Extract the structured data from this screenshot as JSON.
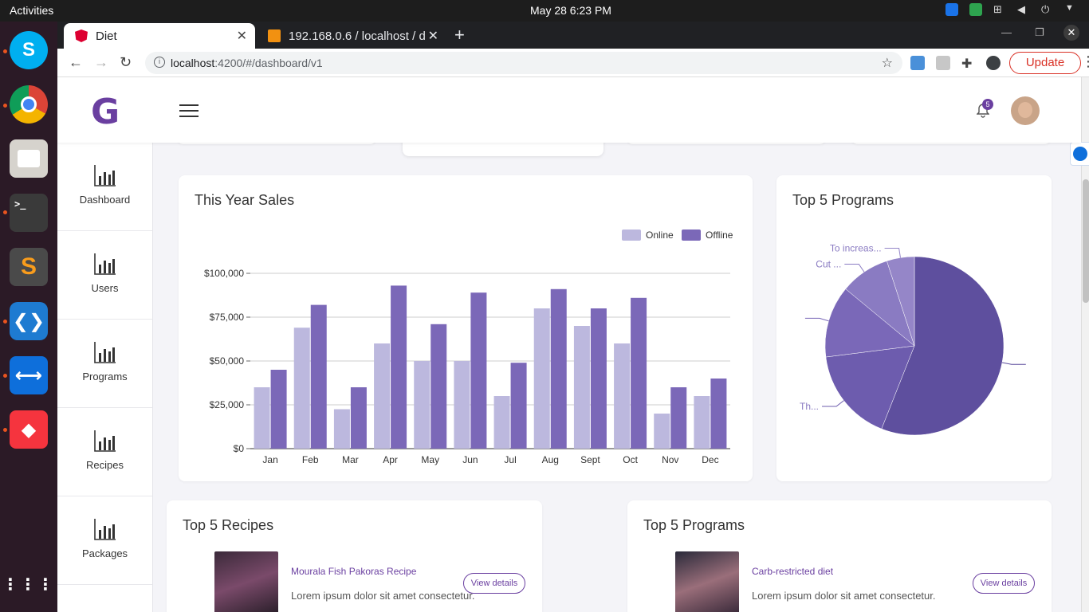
{
  "system": {
    "activities": "Activities",
    "clock": "May 28  6:23 PM"
  },
  "browser": {
    "tabs": [
      {
        "title": "Diet",
        "active": true
      },
      {
        "title": "192.168.0.6 / localhost / d",
        "active": false
      }
    ],
    "url_host": "localhost",
    "url_path": ":4200/#/dashboard/v1",
    "update_label": "Update"
  },
  "app": {
    "logo": "G",
    "notification_count": "5",
    "sidebar": [
      {
        "label": "Dashboard"
      },
      {
        "label": "Users"
      },
      {
        "label": "Programs"
      },
      {
        "label": "Recipes"
      },
      {
        "label": "Packages"
      }
    ]
  },
  "sales_card": {
    "title": "This Year Sales"
  },
  "programs_chart_card": {
    "title": "Top 5 Programs"
  },
  "chart_data": [
    {
      "type": "bar",
      "title": "This Year Sales",
      "categories": [
        "Jan",
        "Feb",
        "Mar",
        "Apr",
        "May",
        "Jun",
        "Jul",
        "Aug",
        "Sept",
        "Oct",
        "Nov",
        "Dec"
      ],
      "series": [
        {
          "name": "Online",
          "color": "#bcb8de",
          "values": [
            35000,
            69000,
            22500,
            60000,
            50000,
            50000,
            30000,
            80000,
            70000,
            60000,
            20000,
            30000
          ]
        },
        {
          "name": "Offline",
          "color": "#7b68b8",
          "values": [
            45000,
            82000,
            35000,
            93000,
            71000,
            89000,
            49000,
            91000,
            80000,
            86000,
            35000,
            40000
          ]
        }
      ],
      "y_ticks": [
        "$0",
        "$25,000",
        "$50,000",
        "$75,000",
        "$100,000"
      ],
      "ylim": [
        0,
        100000
      ],
      "legend": "top-right",
      "grid": true
    },
    {
      "type": "pie",
      "title": "Top 5 Programs",
      "labels": [
        "",
        "Th...",
        "",
        "Cut ...",
        "To increas..."
      ],
      "values": [
        56,
        17,
        13,
        9,
        5
      ],
      "colors": [
        "#5e4f9e",
        "#6d5cae",
        "#7a68b8",
        "#8a7bc2",
        "#9586c8"
      ]
    }
  ],
  "recipes_card": {
    "title": "Top 5 Recipes",
    "items": [
      {
        "name": "Mourala Fish Pakoras Recipe",
        "desc": "Lorem ipsum dolor sit amet consectetur.",
        "button": "View details"
      }
    ]
  },
  "programs_list_card": {
    "title": "Top 5 Programs",
    "items": [
      {
        "name": "Carb-restricted diet",
        "desc": "Lorem ipsum dolor sit amet consectetur.",
        "button": "View details"
      }
    ]
  }
}
